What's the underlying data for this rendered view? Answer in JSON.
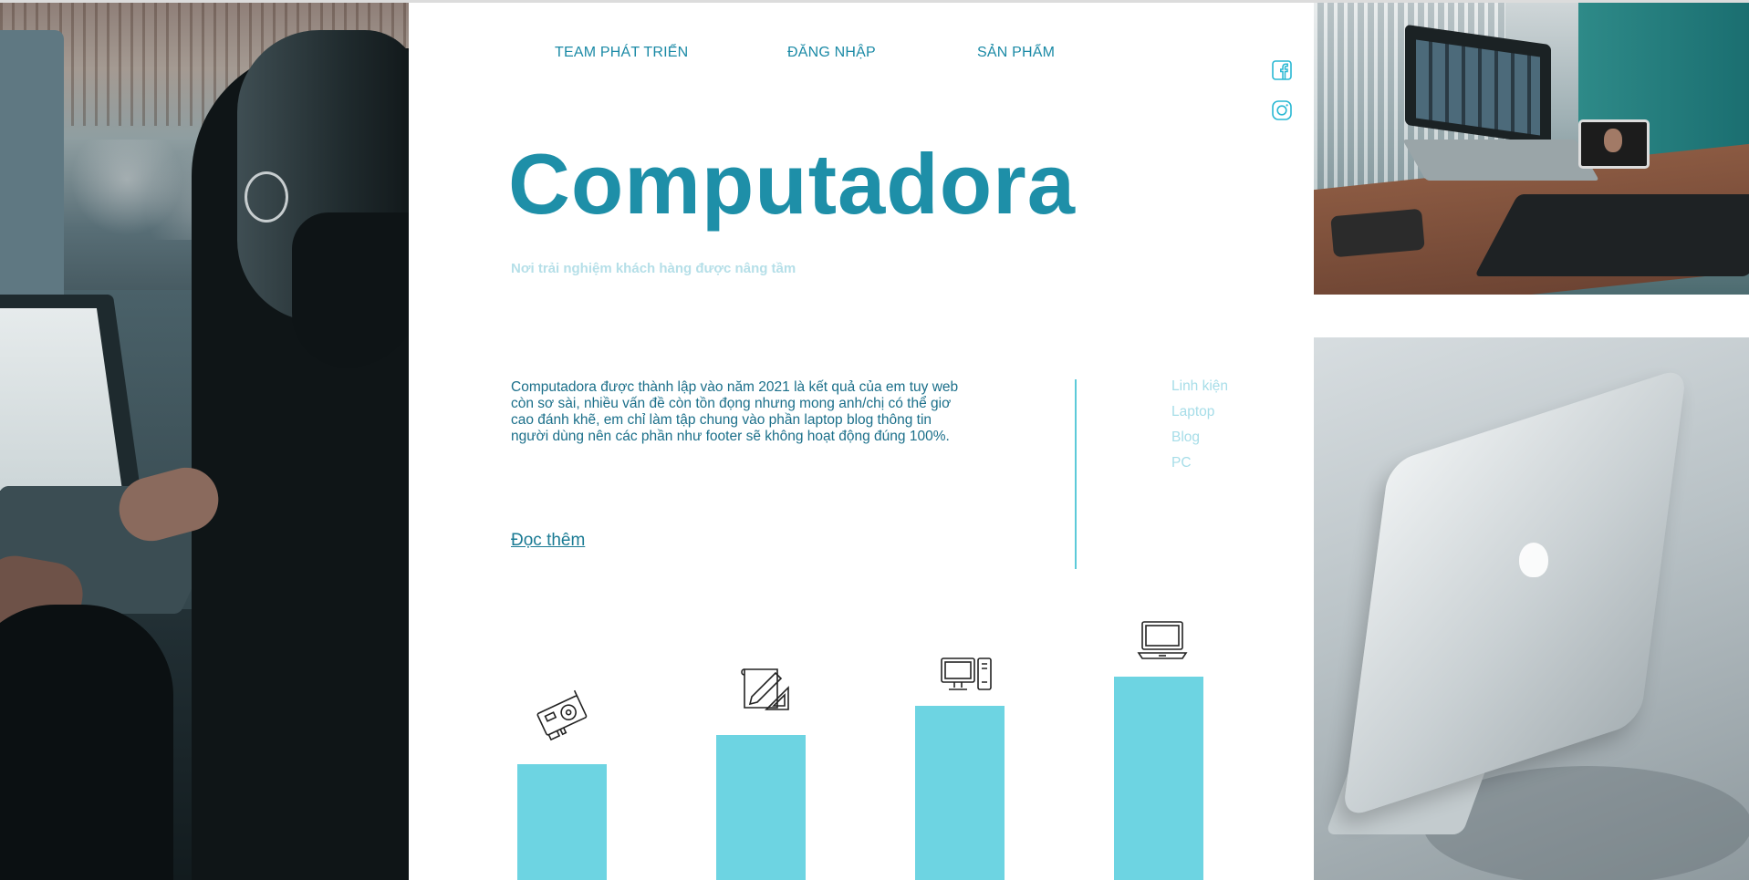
{
  "nav": {
    "items": [
      {
        "label": "TEAM PHÁT TRIỂN"
      },
      {
        "label": "ĐĂNG NHẬP"
      },
      {
        "label": "SẢN PHẨM"
      }
    ]
  },
  "social": {
    "icons": [
      "facebook-icon",
      "instagram-icon"
    ]
  },
  "hero": {
    "title": "Computadora",
    "subtitle": "Nơi trải nghiệm khách hàng được nâng tầm"
  },
  "intro": {
    "text": "Computadora được thành lập vào năm 2021 là kết quả của em tuy web còn sơ sài, nhiều vấn đề còn tồn đọng nhưng mong anh/chị có thể giơ cao đánh khẽ, em chỉ làm tập chung vào phần laptop blog thông tin người dùng nên các phần như footer sẽ không hoạt động đúng 100%.",
    "read_more": "Đọc thêm"
  },
  "side_menu": {
    "items": [
      "Linh kiện",
      "Laptop",
      "Blog",
      "PC"
    ]
  },
  "bars": {
    "items": [
      {
        "icon": "graphics-card-icon",
        "level": 1
      },
      {
        "icon": "drafting-icon",
        "level": 2
      },
      {
        "icon": "desktop-pc-icon",
        "level": 3
      },
      {
        "icon": "laptop-icon",
        "level": 4
      }
    ]
  },
  "colors": {
    "brand": "#1e8fa8",
    "nav": "#1b8aa6",
    "bar": "#6dd4e2",
    "muted": "#a6dde8",
    "divider": "#5ccad9"
  }
}
